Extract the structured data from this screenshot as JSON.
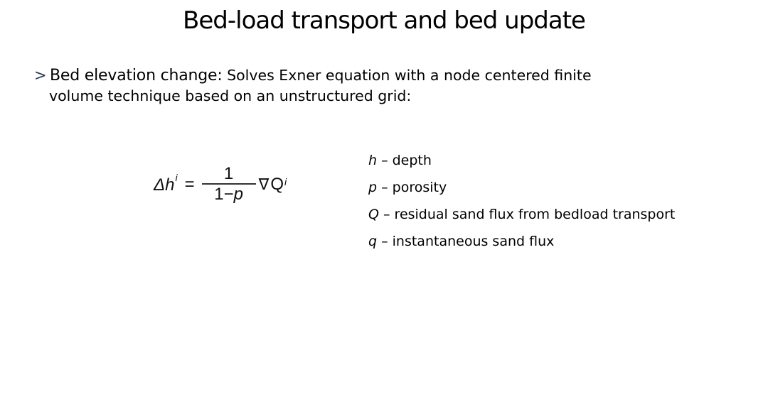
{
  "slide": {
    "title": "Bed-load transport and bed update",
    "bullet": {
      "marker": ">",
      "marker_color": "#2a3a5c",
      "heading": "Bed elevation change:",
      "text_line1": " Solves Exner equation with a node centered finite",
      "text_line2": "volume technique based on an unstructured grid:"
    },
    "equation": {
      "lhs_delta": "Δ",
      "lhs_var": "h",
      "lhs_sup": "i",
      "equals": "=",
      "numerator": "1",
      "denominator_const": "1−",
      "denominator_var": "p",
      "nabla": "∇",
      "rhs_var": "Q",
      "rhs_sup": "i"
    },
    "legend": [
      {
        "symbol": "h",
        "description": " – depth"
      },
      {
        "symbol": "p",
        "description": " – porosity"
      },
      {
        "symbol": "Q",
        "description": " – residual sand flux from bedload transport"
      },
      {
        "symbol": "q",
        "description": " – instantaneous sand flux"
      }
    ]
  }
}
